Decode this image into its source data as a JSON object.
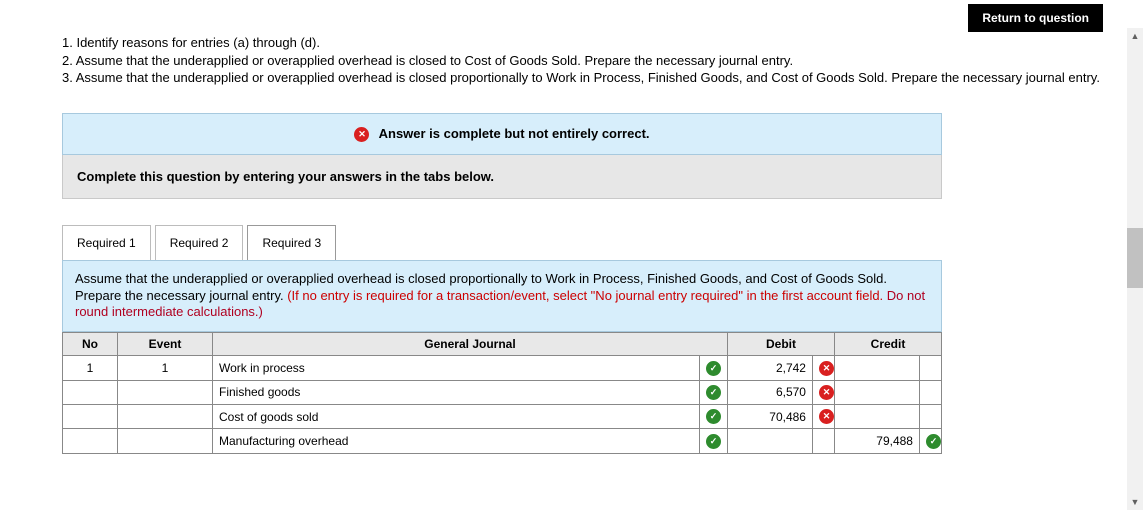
{
  "return_button": "Return to question",
  "instructions": {
    "line1": "1. Identify reasons for entries (a) through (d).",
    "line2": "2. Assume that the underapplied or overapplied overhead is closed to Cost of Goods Sold. Prepare the necessary journal entry.",
    "line3": "3. Assume that the underapplied or overapplied overhead is closed proportionally to Work in Process, Finished Goods, and Cost of Goods Sold. Prepare the necessary journal entry."
  },
  "status_banner": "Answer is complete but not entirely correct.",
  "complete_prompt": "Complete this question by entering your answers in the tabs below.",
  "tabs": {
    "t1": "Required 1",
    "t2": "Required 2",
    "t3": "Required 3"
  },
  "tab_content": {
    "main": "Assume that the underapplied or overapplied overhead is closed proportionally to Work in Process, Finished Goods, and Cost of Goods Sold. Prepare the necessary journal entry. ",
    "hint1": "(If no entry is required for a transaction/event, select \"No journal entry required\" in the first account field. ",
    "hint2": "Do not round intermediate calculations.)"
  },
  "table": {
    "headers": {
      "no": "No",
      "event": "Event",
      "journal": "General Journal",
      "debit": "Debit",
      "credit": "Credit"
    },
    "rows": [
      {
        "no": "1",
        "event": "1",
        "account": "Work in process",
        "account_ok": true,
        "debit": "2,742",
        "debit_ok": false,
        "credit": "",
        "credit_ok": null,
        "indent": false
      },
      {
        "no": "",
        "event": "",
        "account": "Finished goods",
        "account_ok": true,
        "debit": "6,570",
        "debit_ok": false,
        "credit": "",
        "credit_ok": null,
        "indent": false
      },
      {
        "no": "",
        "event": "",
        "account": "Cost of goods sold",
        "account_ok": true,
        "debit": "70,486",
        "debit_ok": false,
        "credit": "",
        "credit_ok": null,
        "indent": false
      },
      {
        "no": "",
        "event": "",
        "account": "Manufacturing overhead",
        "account_ok": true,
        "debit": "",
        "debit_ok": null,
        "credit": "79,488",
        "credit_ok": true,
        "indent": true
      }
    ]
  }
}
